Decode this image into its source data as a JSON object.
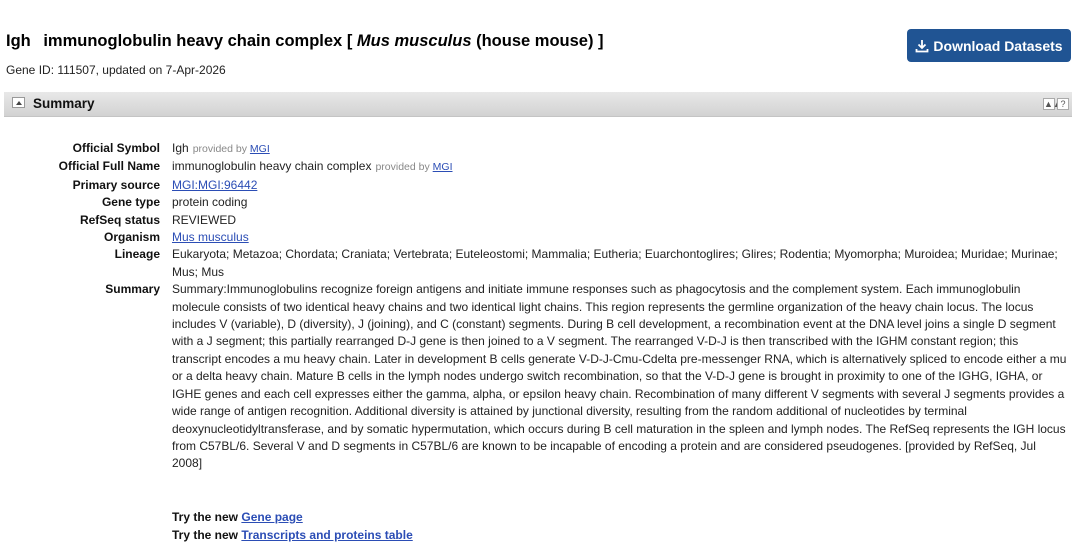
{
  "header": {
    "symbol": "Igh",
    "full_name": "immunoglobulin heavy chain complex [",
    "species": "Mus musculus",
    "common": "(house mouse) ]",
    "download_label": "Download Datasets",
    "gene_id_line": "Gene ID: 111507, updated on 7-Apr-2026"
  },
  "summary_section": {
    "title": "Summary",
    "btn_collapse": "▲▲",
    "btn_help": "?"
  },
  "fields": {
    "official_symbol": {
      "label": "Official Symbol",
      "value": "Igh",
      "provided_by": "provided by",
      "source": "MGI"
    },
    "official_full_name": {
      "label": "Official Full Name",
      "value": "immunoglobulin heavy chain complex",
      "provided_by": "provided by",
      "source": "MGI"
    },
    "primary_source": {
      "label": "Primary source",
      "value": "MGI:MGI:96442"
    },
    "gene_type": {
      "label": "Gene type",
      "value": "protein coding"
    },
    "refseq_status": {
      "label": "RefSeq status",
      "value": "REVIEWED"
    },
    "organism": {
      "label": "Organism",
      "value": "Mus musculus"
    },
    "lineage": {
      "label": "Lineage",
      "value": "Eukaryota; Metazoa; Chordata; Craniata; Vertebrata; Euteleostomi; Mammalia; Eutheria; Euarchontoglires; Glires; Rodentia; Myomorpha; Muroidea; Muridae; Murinae; Mus; Mus"
    },
    "summary": {
      "label": "Summary",
      "value": "Summary:Immunoglobulins recognize foreign antigens and initiate immune responses such as phagocytosis and the complement system. Each immunoglobulin molecule consists of two identical heavy chains and two identical light chains. This region represents the germline organization of the heavy chain locus. The locus includes V (variable), D (diversity), J (joining), and C (constant) segments. During B cell development, a recombination event at the DNA level joins a single D segment with a J segment; this partially rearranged D-J gene is then joined to a V segment. The rearranged V-D-J is then transcribed with the IGHM constant region; this transcript encodes a mu heavy chain. Later in development B cells generate V-D-J-Cmu-Cdelta pre-messenger RNA, which is alternatively spliced to encode either a mu or a delta heavy chain. Mature B cells in the lymph nodes undergo switch recombination, so that the V-D-J gene is brought in proximity to one of the IGHG, IGHA, or IGHE genes and each cell expresses either the gamma, alpha, or epsilon heavy chain. Recombination of many different V segments with several J segments provides a wide range of antigen recognition. Additional diversity is attained by junctional diversity, resulting from the random additional of nucleotides by terminal deoxynucleotidyltransferase, and by somatic hypermutation, which occurs during B cell maturation in the spleen and lymph nodes. The RefSeq represents the IGH locus from C57BL/6. Several V and D segments in C57BL/6 are known to be incapable of encoding a protein and are considered pseudogenes. [provided by RefSeq, Jul 2008]"
    }
  },
  "try_links": {
    "prefix": "Try the new",
    "gene_page": "Gene page",
    "transcripts": "Transcripts and proteins table"
  },
  "colors": {
    "button_bg": "#205493",
    "link": "#2b4db5"
  }
}
